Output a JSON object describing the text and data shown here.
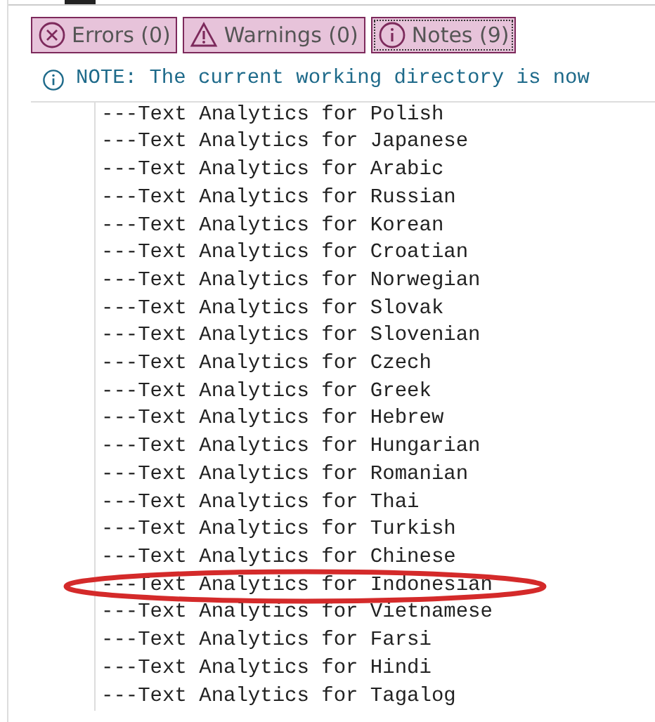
{
  "filters": [
    {
      "kind": "error",
      "label": "Errors (0)",
      "selected": false
    },
    {
      "kind": "warning",
      "label": "Warnings (0)",
      "selected": false
    },
    {
      "kind": "note",
      "label": "Notes (9)",
      "selected": true
    }
  ],
  "note": {
    "text": "NOTE: The current working directory is now"
  },
  "log_lines": [
    {
      "text": "---Text Analytics for Polish",
      "circled": false
    },
    {
      "text": "---Text Analytics for Japanese",
      "circled": false
    },
    {
      "text": "---Text Analytics for Arabic",
      "circled": false
    },
    {
      "text": "---Text Analytics for Russian",
      "circled": false
    },
    {
      "text": "---Text Analytics for Korean",
      "circled": false
    },
    {
      "text": "---Text Analytics for Croatian",
      "circled": false
    },
    {
      "text": "---Text Analytics for Norwegian",
      "circled": false
    },
    {
      "text": "---Text Analytics for Slovak",
      "circled": false
    },
    {
      "text": "---Text Analytics for Slovenian",
      "circled": false
    },
    {
      "text": "---Text Analytics for Czech",
      "circled": false
    },
    {
      "text": "---Text Analytics for Greek",
      "circled": false
    },
    {
      "text": "---Text Analytics for Hebrew",
      "circled": false
    },
    {
      "text": "---Text Analytics for Hungarian",
      "circled": false
    },
    {
      "text": "---Text Analytics for Romanian",
      "circled": false
    },
    {
      "text": "---Text Analytics for Thai",
      "circled": false
    },
    {
      "text": "---Text Analytics for Turkish",
      "circled": false
    },
    {
      "text": "---Text Analytics for Chinese",
      "circled": false
    },
    {
      "text": "---Text Analytics for Indonesian",
      "circled": true
    },
    {
      "text": "---Text Analytics for Vietnamese",
      "circled": false
    },
    {
      "text": "---Text Analytics for Farsi",
      "circled": false
    },
    {
      "text": "---Text Analytics for Hindi",
      "circled": false
    },
    {
      "text": "---Text Analytics for Tagalog",
      "circled": false
    }
  ]
}
